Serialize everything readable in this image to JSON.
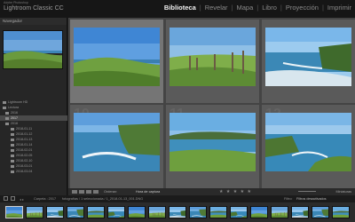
{
  "app": {
    "brand_sub": "Adobe Photoshop",
    "brand_name": "Lightroom Classic CC"
  },
  "modules": [
    {
      "label": "Biblioteca",
      "active": true
    },
    {
      "label": "Revelar",
      "active": false
    },
    {
      "label": "Mapa",
      "active": false
    },
    {
      "label": "Libro",
      "active": false
    },
    {
      "label": "Proyección",
      "active": false
    },
    {
      "label": "Imprimir",
      "active": false
    }
  ],
  "navigator": {
    "title": "Navegador"
  },
  "folders": [
    {
      "name": "Lightroom HD",
      "count": "",
      "selected": false
    },
    {
      "name": "Lectura",
      "count": "",
      "selected": false
    },
    {
      "name": "2016",
      "count": "",
      "selected": false
    },
    {
      "name": "2017",
      "count": "",
      "selected": true
    },
    {
      "name": "2018",
      "count": "",
      "selected": false
    },
    {
      "name": "2018-01-11",
      "count": "",
      "selected": false
    },
    {
      "name": "2018-01-12",
      "count": "",
      "selected": false
    },
    {
      "name": "2018-01-13",
      "count": "",
      "selected": false
    },
    {
      "name": "2018-01-14",
      "count": "",
      "selected": false
    },
    {
      "name": "2018-02-01",
      "count": "",
      "selected": false
    },
    {
      "name": "2018-02-05",
      "count": "",
      "selected": false
    },
    {
      "name": "2018-02-10",
      "count": "",
      "selected": false
    },
    {
      "name": "2018-03-01",
      "count": "",
      "selected": false
    },
    {
      "name": "2018-03-04",
      "count": "",
      "selected": false
    }
  ],
  "left_buttons": {
    "import": "Importar...",
    "export": "Exportar..."
  },
  "grid": {
    "cells": [
      {
        "num": "",
        "label": "",
        "selected": true,
        "scene": "meadow"
      },
      {
        "num": "",
        "label": "",
        "selected": false,
        "scene": "fence"
      },
      {
        "num": "",
        "label": "",
        "selected": false,
        "scene": "cliff"
      },
      {
        "num": "10",
        "label": "",
        "selected": false,
        "scene": "coast"
      },
      {
        "num": "11",
        "label": "",
        "selected": false,
        "scene": "bay"
      },
      {
        "num": "12",
        "label": "",
        "selected": false,
        "scene": "cove"
      }
    ]
  },
  "toolbar": {
    "sort_label": "Ordenar:",
    "sort_value": "Hora de captura",
    "stars": "★ ★ ★ ★ ★",
    "thumbnails_label": "Miniaturas"
  },
  "filmstrip_bar": {
    "source": "Carpeta : 2017",
    "path_text": "fotografías / 1 seleccionada / 1_2018-01-13_001.DNG",
    "filter_label": "Filtro:",
    "filter_value": "Filtros desactivados"
  },
  "filmstrip": {
    "count": 17,
    "selected_index": 0
  }
}
